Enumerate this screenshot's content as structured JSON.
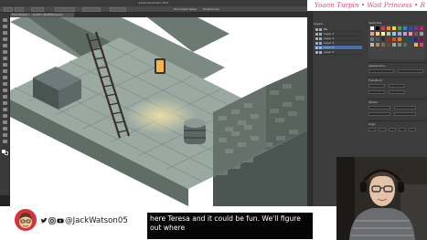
{
  "app": {
    "window_title": "Adobe Illustrator 2021"
  },
  "brand": {
    "text": "Yoann Turpin • Wait Princess • R"
  },
  "document": {
    "tab_label": "Ph4-Stream-... @ 66% (RGB/Preview)"
  },
  "control_bar": [
    "Document Setup",
    "Preferences"
  ],
  "layers_panel": {
    "title": "Layers",
    "items": [
      {
        "label": "BG"
      },
      {
        "label": "Layer 1"
      },
      {
        "label": "Layer 2"
      },
      {
        "label": "Layer 3"
      },
      {
        "label": "Layer 4"
      },
      {
        "label": "Layer 5"
      }
    ]
  },
  "properties_panel": {
    "sections": [
      "Swatches",
      "Appearance",
      "Transform",
      "Stroke",
      "Align"
    ]
  },
  "social": {
    "handle": "@JackWatson05"
  },
  "subtitle": {
    "text": "here Teresa and it could be fun. We'll figure out where"
  },
  "colors": {
    "accent": "#e0457a",
    "selection": "#4b6eaf",
    "avatar_bg": "#d6333a",
    "lamp": "#f2b84a"
  }
}
